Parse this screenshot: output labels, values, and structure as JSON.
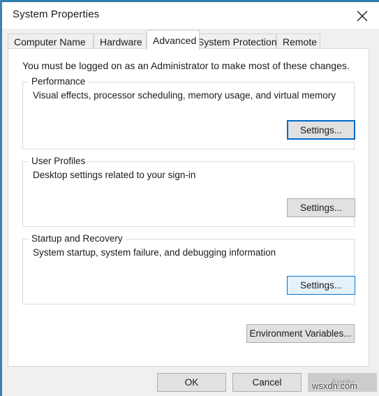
{
  "window": {
    "title": "System Properties",
    "close_icon": "close-icon",
    "accent_color": "#2d7dae"
  },
  "tabs": [
    {
      "label": "Computer Name",
      "selected": false
    },
    {
      "label": "Hardware",
      "selected": false
    },
    {
      "label": "Advanced",
      "selected": true
    },
    {
      "label": "System Protection",
      "selected": false
    },
    {
      "label": "Remote",
      "selected": false
    }
  ],
  "page": {
    "admin_note": "You must be logged on as an Administrator to make most of these changes.",
    "groups": [
      {
        "legend": "Performance",
        "description": "Visual effects, processor scheduling, memory usage, and virtual memory",
        "button_label": "Settings...",
        "button_state": "default-focus"
      },
      {
        "legend": "User Profiles",
        "description": "Desktop settings related to your sign-in",
        "button_label": "Settings...",
        "button_state": "normal"
      },
      {
        "legend": "Startup and Recovery",
        "description": "System startup, system failure, and debugging information",
        "button_label": "Settings...",
        "button_state": "hovered"
      }
    ],
    "environment_variables_label": "Environment Variables..."
  },
  "footer": {
    "ok_label": "OK",
    "cancel_label": "Cancel",
    "apply_label": "Apply",
    "apply_disabled": true
  },
  "watermark": {
    "text": "wsxdn.com"
  }
}
